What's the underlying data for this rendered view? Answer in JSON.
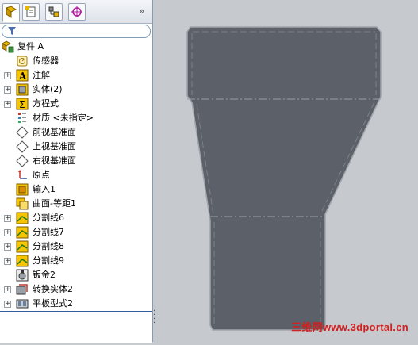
{
  "tree": {
    "root_label": "复件 A",
    "items": [
      {
        "label": "传感器",
        "icon": "sensor-icon"
      },
      {
        "label": "注解",
        "icon": "annotation-icon"
      },
      {
        "label": "实体(2)",
        "icon": "solid-bodies-icon"
      },
      {
        "label": "方程式",
        "icon": "equations-icon"
      },
      {
        "label": "材质 <未指定>",
        "icon": "material-icon"
      },
      {
        "label": "前视基准面",
        "icon": "plane-icon"
      },
      {
        "label": "上视基准面",
        "icon": "plane-icon"
      },
      {
        "label": "右视基准面",
        "icon": "plane-icon"
      },
      {
        "label": "原点",
        "icon": "origin-icon"
      },
      {
        "label": "输入1",
        "icon": "import-icon"
      },
      {
        "label": "曲面-等距1",
        "icon": "surface-offset-icon"
      },
      {
        "label": "分割线6",
        "icon": "split-line-icon"
      },
      {
        "label": "分割线7",
        "icon": "split-line-icon"
      },
      {
        "label": "分割线8",
        "icon": "split-line-icon"
      },
      {
        "label": "分割线9",
        "icon": "split-line-icon"
      },
      {
        "label": "钣金2",
        "icon": "sheet-metal-icon"
      },
      {
        "label": "转换实体2",
        "icon": "convert-body-icon"
      },
      {
        "label": "平板型式2",
        "icon": "flat-pattern-icon"
      }
    ]
  },
  "panel_tabs": [
    "feature-manager-tab",
    "property-manager-tab",
    "configuration-manager-tab",
    "dimxpert-tab"
  ],
  "watermark": "三维网www.3dportal.cn",
  "colors": {
    "viewport_bg": "#c6c9ce",
    "part_fill": "#5c6068",
    "part_edge": "#a0a4ab",
    "watermark": "#d21f1f"
  }
}
